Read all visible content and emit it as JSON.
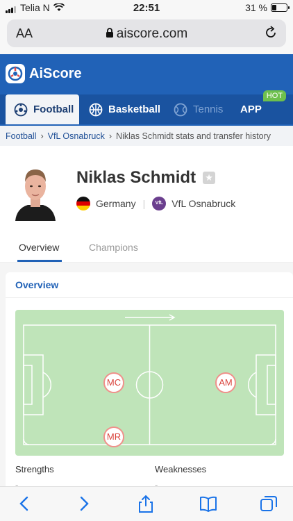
{
  "status": {
    "carrier": "Telia N",
    "time": "22:51",
    "battery": "31 %",
    "battery_fraction": 0.31
  },
  "browser": {
    "text_size_label": "AA",
    "domain": "aiscore.com",
    "icons": [
      "lock-icon",
      "reload-icon"
    ]
  },
  "brand": {
    "name": "AiScore"
  },
  "nav": {
    "tabs": [
      {
        "label": "Football",
        "icon": "football-icon"
      },
      {
        "label": "Basketball",
        "icon": "basketball-icon"
      },
      {
        "label": "Tennis",
        "icon": "tennis-icon"
      },
      {
        "label": "APP"
      }
    ],
    "hot_badge": "HOT"
  },
  "breadcrumb": {
    "items": [
      "Football",
      "VfL Osnabruck",
      "Niklas Schmidt stats and transfer history"
    ]
  },
  "player": {
    "name": "Niklas Schmidt",
    "country": "Germany",
    "club": "VfL Osnabruck",
    "club_badge": "VfL"
  },
  "subtabs": [
    "Overview",
    "Champions"
  ],
  "overview": {
    "title": "Overview",
    "positions": [
      "MC",
      "AM",
      "MR"
    ],
    "strengths_label": "Strengths",
    "weaknesses_label": "Weaknesses",
    "strengths_value": "-",
    "weaknesses_value": "-"
  },
  "colors": {
    "brand": "#2162b7",
    "pitch": "#bfe4b9",
    "position_ring": "#f0908b"
  }
}
